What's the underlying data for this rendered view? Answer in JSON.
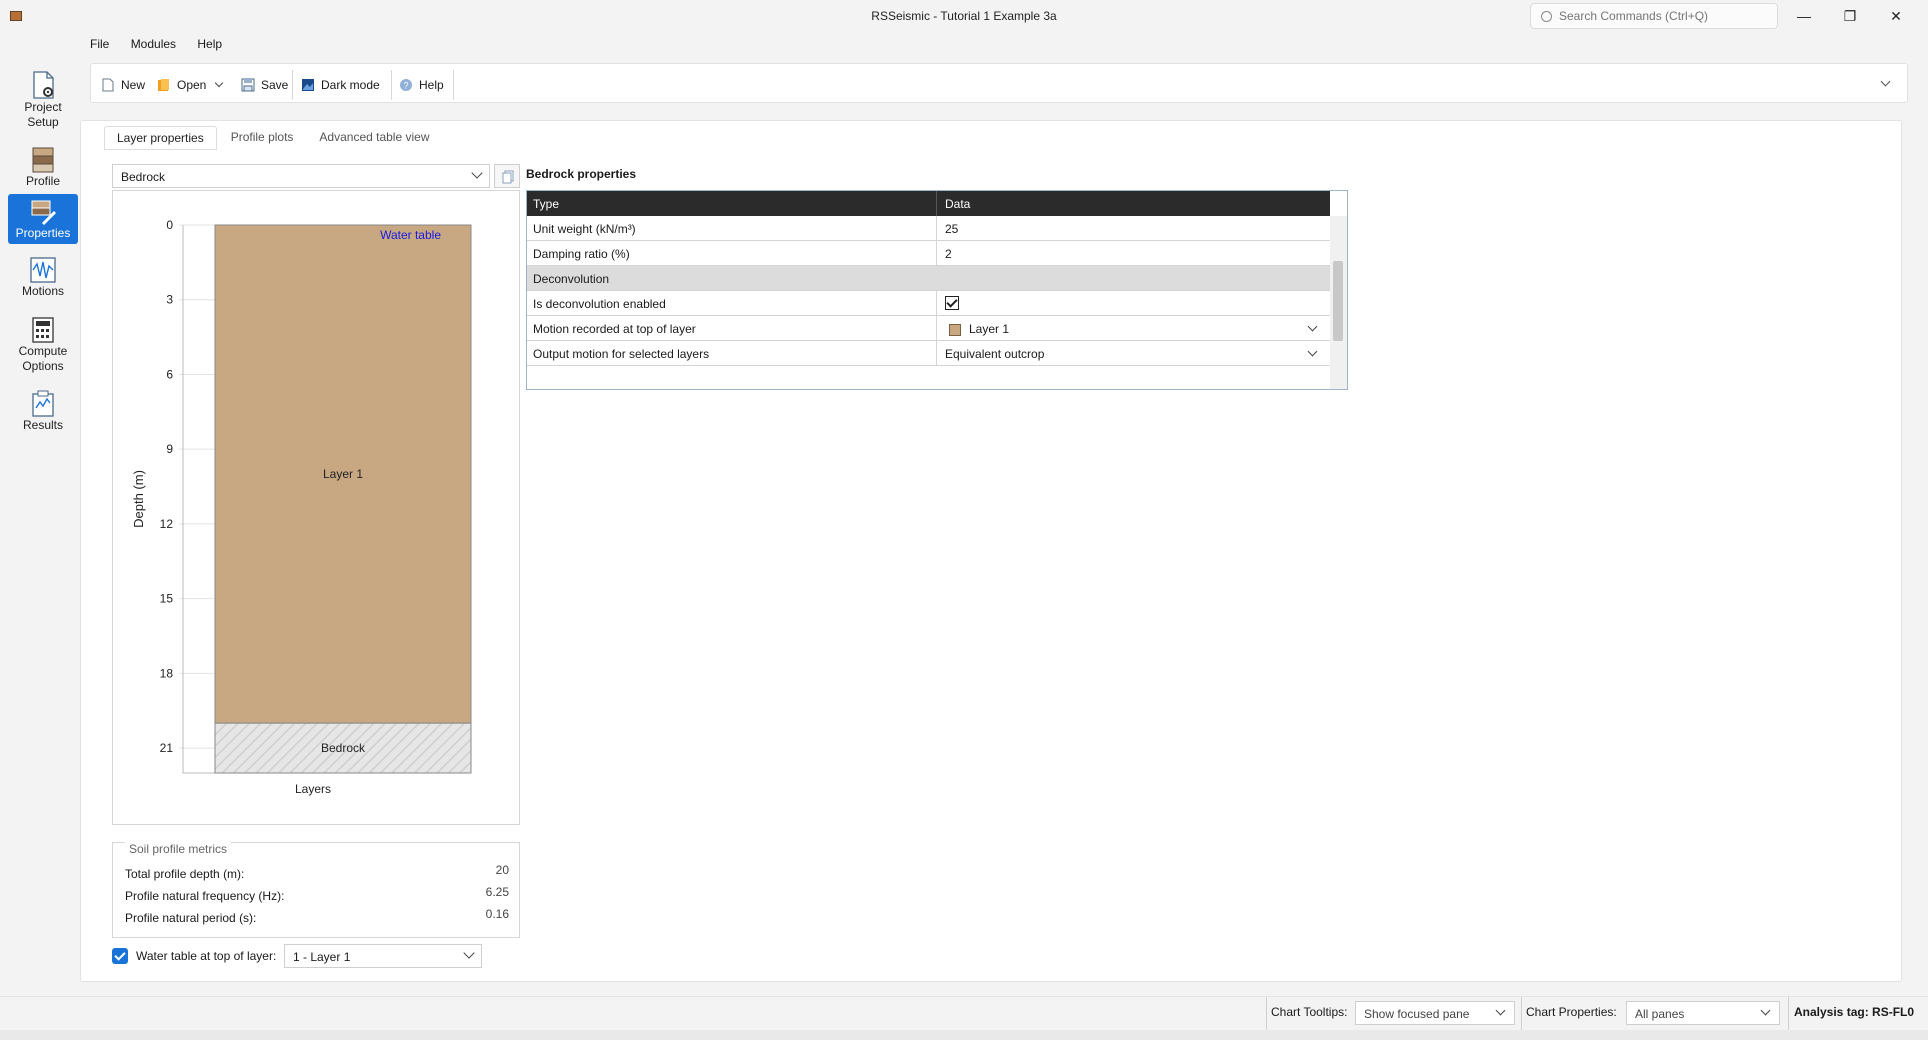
{
  "window": {
    "title": "RSSeismic - Tutorial 1 Example 3a",
    "search_placeholder": "Search Commands (Ctrl+Q)",
    "minimize": "—",
    "maximize": "❐",
    "close": "✕"
  },
  "menu": [
    "File",
    "Modules",
    "Help"
  ],
  "toolbar": {
    "new": "New",
    "open": "Open",
    "save": "Save",
    "dark_mode": "Dark mode",
    "help": "Help"
  },
  "nav": [
    {
      "label": "Project Setup",
      "icon": "project-setup-icon"
    },
    {
      "label": "Profile",
      "icon": "profile-icon"
    },
    {
      "label": "Properties",
      "icon": "properties-icon",
      "active": true
    },
    {
      "label": "Motions",
      "icon": "motions-icon"
    },
    {
      "label": "Compute Options",
      "icon": "compute-options-icon"
    },
    {
      "label": "Results",
      "icon": "results-icon"
    }
  ],
  "tabs": [
    "Layer properties",
    "Profile plots",
    "Advanced table view"
  ],
  "layer_select": {
    "value": "Bedrock"
  },
  "profile_chart": {
    "ylabel": "Depth (m)",
    "xlabel": "Layers",
    "water_table_label": "Water table",
    "y_ticks": [
      "0",
      "3",
      "6",
      "9",
      "12",
      "15",
      "18",
      "21"
    ],
    "layers": [
      {
        "name": "Layer 1",
        "top": 0,
        "bottom": 20,
        "color": "#c8a882"
      },
      {
        "name": "Bedrock",
        "top": 20,
        "bottom": 22,
        "color": "#e0e0e0"
      }
    ]
  },
  "metrics": {
    "header": "Soil profile metrics",
    "rows": [
      {
        "label": "Total profile depth (m):",
        "value": "20"
      },
      {
        "label": "Profile natural frequency (Hz):",
        "value": "6.25"
      },
      {
        "label": "Profile natural period (s):",
        "value": "0.16"
      }
    ]
  },
  "water_table": {
    "label": "Water table at top of layer:",
    "checked": true,
    "value": "1 - Layer 1"
  },
  "properties": {
    "title": "Bedrock properties",
    "col_type": "Type",
    "col_data": "Data",
    "rows": {
      "unit_weight": {
        "label": "Unit weight (kN/m³)",
        "value": "25"
      },
      "damping": {
        "label": "Damping ratio (%)",
        "value": "2"
      },
      "group": "Deconvolution",
      "deconv_enabled": {
        "label": "Is deconvolution enabled",
        "checked": true
      },
      "motion_recorded": {
        "label": "Motion recorded at top of layer",
        "value": "Layer 1"
      },
      "output_motion": {
        "label": "Output motion for selected layers",
        "value": "Equivalent outcrop"
      }
    }
  },
  "statusbar": {
    "tooltips_label": "Chart Tooltips:",
    "tooltips_value": "Show focused pane",
    "properties_label": "Chart Properties:",
    "properties_value": "All panes",
    "analysis_tag": "Analysis tag: RS-FL0"
  }
}
